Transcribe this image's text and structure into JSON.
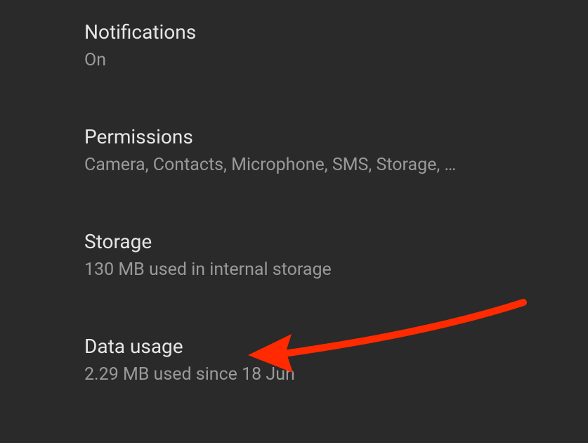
{
  "settings": {
    "notifications": {
      "title": "Notifications",
      "subtitle": "On"
    },
    "permissions": {
      "title": "Permissions",
      "subtitle": "Camera, Contacts, Microphone, SMS, Storage, …"
    },
    "storage": {
      "title": "Storage",
      "subtitle": "130 MB used in internal storage"
    },
    "dataUsage": {
      "title": "Data usage",
      "subtitle": "2.29 MB used since 18 Jun"
    }
  }
}
